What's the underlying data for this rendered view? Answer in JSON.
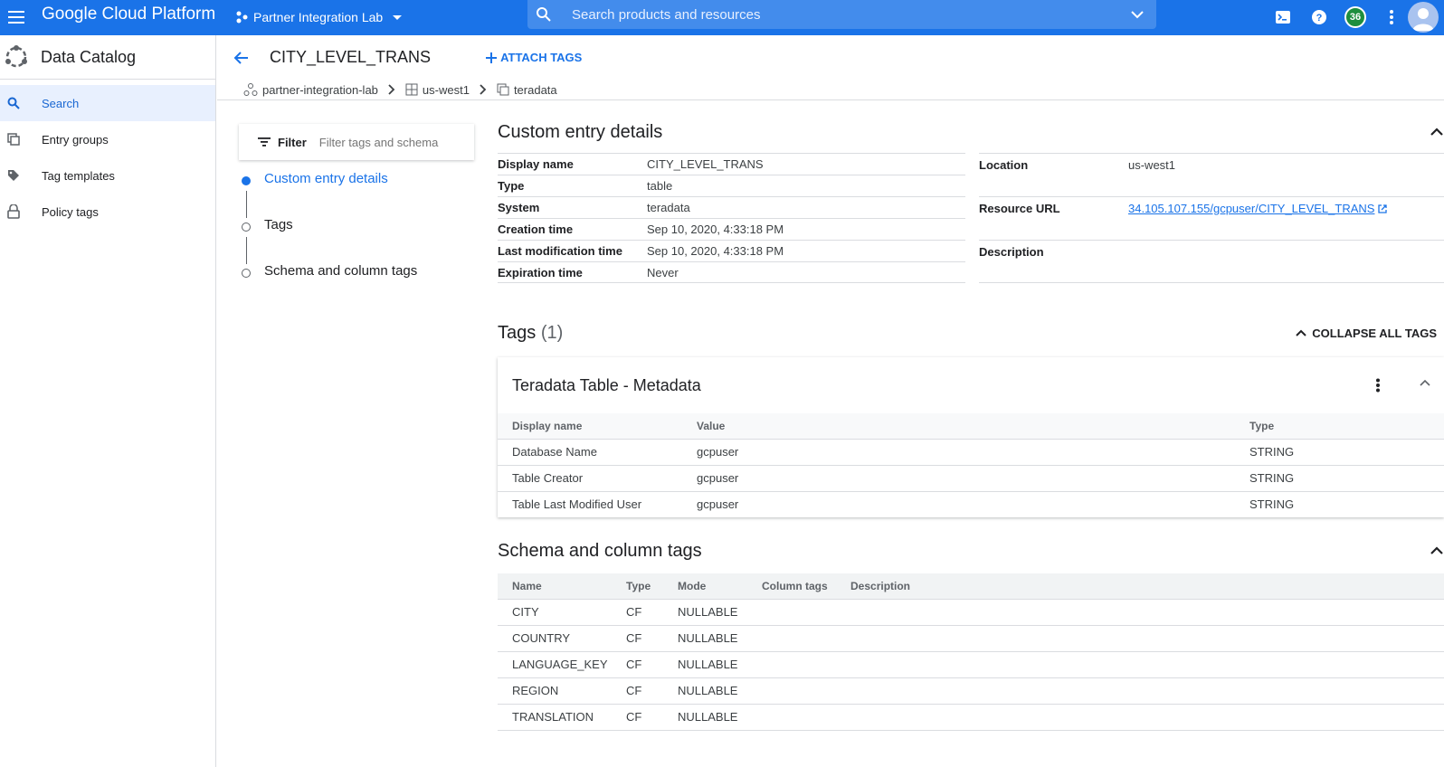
{
  "topbar": {
    "brand": "Google Cloud Platform",
    "project": "Partner Integration Lab",
    "search_placeholder": "Search products and resources",
    "notification_count": "36",
    "icons": [
      "menu-icon",
      "project-icon",
      "search-icon",
      "chevron-down-icon",
      "terminal-icon",
      "help-icon",
      "more-vert-icon",
      "avatar-icon"
    ]
  },
  "sidebar": {
    "title": "Data Catalog",
    "items": [
      {
        "label": "Search",
        "icon": "search-icon",
        "active": true
      },
      {
        "label": "Entry groups",
        "icon": "entry-groups-icon",
        "active": false
      },
      {
        "label": "Tag templates",
        "icon": "tag-icon",
        "active": false
      },
      {
        "label": "Policy tags",
        "icon": "lock-icon",
        "active": false
      }
    ]
  },
  "header": {
    "entry_name": "CITY_LEVEL_TRANS",
    "attach_label": "ATTACH TAGS"
  },
  "breadcrumb": [
    "partner-integration-lab",
    "us-west1",
    "teradata"
  ],
  "filter": {
    "label": "Filter",
    "placeholder": "Filter tags and schema"
  },
  "toc": [
    "Custom entry details",
    "Tags",
    "Schema and column tags"
  ],
  "details": {
    "title": "Custom entry details",
    "left": [
      {
        "k": "Display name",
        "v": "CITY_LEVEL_TRANS"
      },
      {
        "k": "Type",
        "v": "table"
      },
      {
        "k": "System",
        "v": "teradata"
      },
      {
        "k": "Creation time",
        "v": "Sep 10, 2020, 4:33:18 PM"
      },
      {
        "k": "Last modification time",
        "v": "Sep 10, 2020, 4:33:18 PM"
      },
      {
        "k": "Expiration time",
        "v": "Never"
      }
    ],
    "location_k": "Location",
    "location_v": "us-west1",
    "url_k": "Resource URL",
    "url_v": "34.105.107.155/gcpuser/CITY_LEVEL_TRANS",
    "desc_k": "Description"
  },
  "tags": {
    "title": "Tags",
    "count": "(1)",
    "collapse_label": "COLLAPSE ALL TAGS",
    "card_title": "Teradata Table - Metadata",
    "columns": [
      "Display name",
      "Value",
      "Type"
    ],
    "rows": [
      [
        "Database Name",
        "gcpuser",
        "STRING"
      ],
      [
        "Table Creator",
        "gcpuser",
        "STRING"
      ],
      [
        "Table Last Modified User",
        "gcpuser",
        "STRING"
      ]
    ]
  },
  "schema": {
    "title": "Schema and column tags",
    "columns": [
      "Name",
      "Type",
      "Mode",
      "Column tags",
      "Description"
    ],
    "rows": [
      [
        "CITY",
        "CF",
        "NULLABLE",
        "",
        ""
      ],
      [
        "COUNTRY",
        "CF",
        "NULLABLE",
        "",
        ""
      ],
      [
        "LANGUAGE_KEY",
        "CF",
        "NULLABLE",
        "",
        ""
      ],
      [
        "REGION",
        "CF",
        "NULLABLE",
        "",
        ""
      ],
      [
        "TRANSLATION",
        "CF",
        "NULLABLE",
        "",
        ""
      ]
    ]
  }
}
